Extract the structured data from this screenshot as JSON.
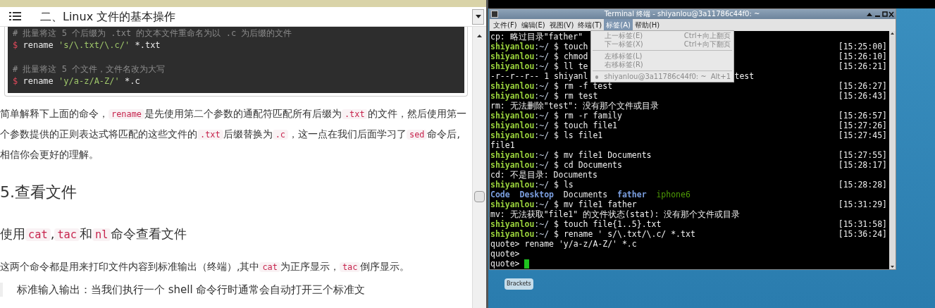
{
  "doc": {
    "title": "二、Linux 文件的基本操作",
    "code_lines": [
      {
        "kind": "comment",
        "text": "# 批量将这 5 个后缀为 .txt 的文本文件重命名为以 .c 为后缀的文件"
      },
      {
        "kind": "command",
        "prompt": "$",
        "cmd": "rename",
        "arg": "'s/\\.txt/\\.c/'",
        "rest": "*.txt"
      },
      {
        "kind": "blank"
      },
      {
        "kind": "comment",
        "text": "# 批量将这 5 个文件，文件名改为大写"
      },
      {
        "kind": "command",
        "prompt": "$",
        "cmd": "rename",
        "arg": "'y/a-z/A-Z/'",
        "rest": "*.c"
      }
    ],
    "blocks": [
      {
        "kind": "paragraph",
        "segments": [
          {
            "kind": "text",
            "text": "简单解释下上面的命令，"
          },
          {
            "kind": "code",
            "text": "rename"
          },
          {
            "kind": "text",
            "text": "是先使用第二个参数的通配符匹配所有后缀为"
          },
          {
            "kind": "code",
            "text": ".txt"
          },
          {
            "kind": "text",
            "text": "的文件，然后使用第一个参数提供的正则表达式将匹配的这些文件的"
          },
          {
            "kind": "code",
            "text": ".txt"
          },
          {
            "kind": "text",
            "text": "后缀替换为"
          },
          {
            "kind": "code",
            "text": ".c"
          },
          {
            "kind": "text",
            "text": "，这一点在我们后面学习了"
          },
          {
            "kind": "code",
            "text": "sed"
          },
          {
            "kind": "text",
            "text": "命令后,相信你会更好的理解。"
          }
        ]
      },
      {
        "kind": "h2",
        "segments": [
          {
            "kind": "text",
            "text": "5.查看文件"
          }
        ]
      },
      {
        "kind": "h3",
        "segments": [
          {
            "kind": "text",
            "text": "使用"
          },
          {
            "kind": "code",
            "text": "cat"
          },
          {
            "kind": "text",
            "text": ","
          },
          {
            "kind": "code",
            "text": "tac"
          },
          {
            "kind": "text",
            "text": "和"
          },
          {
            "kind": "code",
            "text": "nl"
          },
          {
            "kind": "text",
            "text": "命令查看文件"
          }
        ]
      },
      {
        "kind": "paragraph",
        "segments": [
          {
            "kind": "text",
            "text": "这两个命令都是用来打印文件内容到标准输出（终端）,其中"
          },
          {
            "kind": "code",
            "text": "cat"
          },
          {
            "kind": "text",
            "text": "为正序显示，"
          },
          {
            "kind": "code",
            "text": "tac"
          },
          {
            "kind": "text",
            "text": "倒序显示。"
          }
        ]
      },
      {
        "kind": "quote",
        "segments": [
          {
            "kind": "text",
            "text": "标准输入输出：当我们执行一个 shell 命令行时通常会自动打开三个标准文"
          }
        ]
      }
    ]
  },
  "terminal": {
    "title": "Terminal 终端 - shiyanlou@3a11786c44f0: ~",
    "menus": [
      {
        "label": "文件(F)",
        "selected": false
      },
      {
        "label": "编辑(E)",
        "selected": false
      },
      {
        "label": "视图(V)",
        "selected": false
      },
      {
        "label": "终端(T)",
        "selected": false
      },
      {
        "label": "标签(A)",
        "selected": true
      },
      {
        "label": "帮助(H)",
        "selected": false
      }
    ],
    "open_menu": [
      {
        "kind": "item",
        "label": "上一标签(E)",
        "shortcut": "Ctrl+向上翻页",
        "disabled": true
      },
      {
        "kind": "item",
        "label": "下一标签(X)",
        "shortcut": "Ctrl+向下翻页",
        "disabled": true
      },
      {
        "kind": "separator"
      },
      {
        "kind": "item",
        "label": "左移标签(L)",
        "disabled": true
      },
      {
        "kind": "item",
        "label": "右移标签(R)",
        "disabled": true
      },
      {
        "kind": "separator"
      },
      {
        "kind": "radio",
        "label": "shiyanlou@3a11786c44f0: ~",
        "shortcut": "Alt+1",
        "disabled": true
      }
    ],
    "lines": [
      {
        "kind": "output",
        "text": "cp: 略过目录\"father\""
      },
      {
        "kind": "prompt",
        "user": "shiyanlou",
        "path": ":~/",
        "command": "$ touch",
        "time": "[15:25:00]"
      },
      {
        "kind": "prompt",
        "user": "shiyanlou",
        "path": ":~/",
        "command": "$ chmod",
        "time": "[15:26:10]"
      },
      {
        "kind": "prompt",
        "user": "shiyanlou",
        "path": ":~/",
        "command": "$ ll te",
        "time": "[15:26:21]"
      },
      {
        "kind": "output",
        "text": "-r--r--r-- 1 shiyanl",
        "tail": "test"
      },
      {
        "kind": "prompt",
        "user": "shiyanlou",
        "path": ":~/",
        "command": "$ rm -f test",
        "time": "[15:26:27]"
      },
      {
        "kind": "prompt",
        "user": "shiyanlou",
        "path": ":~/",
        "command": "$ rm test",
        "time": "[15:26:43]"
      },
      {
        "kind": "output",
        "text": "rm: 无法删除\"test\": 没有那个文件或目录"
      },
      {
        "kind": "prompt",
        "user": "shiyanlou",
        "path": ":~/",
        "command": "$ rm -r family",
        "time": "[15:26:57]"
      },
      {
        "kind": "prompt",
        "user": "shiyanlou",
        "path": ":~/",
        "command": "$ touch file1",
        "time": "[15:27:26]"
      },
      {
        "kind": "prompt",
        "user": "shiyanlou",
        "path": ":~/",
        "command": "$ ls file1",
        "time": "[15:27:45]"
      },
      {
        "kind": "output",
        "text": "file1"
      },
      {
        "kind": "prompt",
        "user": "shiyanlou",
        "path": ":~/",
        "command": "$ mv file1 Documents",
        "time": "[15:27:55]"
      },
      {
        "kind": "prompt",
        "user": "shiyanlou",
        "path": ":~/",
        "command": "$ cd Documents",
        "time": "[15:28:17]"
      },
      {
        "kind": "output",
        "text": "cd: 不是目录: Documents"
      },
      {
        "kind": "prompt",
        "user": "shiyanlou",
        "path": ":~/",
        "command": "$ ls",
        "time": "[15:28:28]"
      },
      {
        "kind": "listing",
        "entries": [
          {
            "name": "Code",
            "color": "#7b9fe0",
            "bold": true
          },
          {
            "name": "Desktop",
            "color": "#7b9fe0",
            "bold": true
          },
          {
            "name": "Documents",
            "color": "#e8e8e8",
            "bold": false
          },
          {
            "name": "father",
            "color": "#7b9fe0",
            "bold": true
          },
          {
            "name": "iphone6",
            "color": "#4e9a06",
            "bold": false
          }
        ]
      },
      {
        "kind": "prompt",
        "user": "shiyanlou",
        "path": ":~/",
        "command": "$ mv file1 father",
        "time": "[15:31:29]"
      },
      {
        "kind": "output",
        "text": "mv: 无法获取\"file1\" 的文件状态(stat): 没有那个文件或目录"
      },
      {
        "kind": "prompt",
        "user": "shiyanlou",
        "path": ":~/",
        "command": "$ touch file{1..5}.txt",
        "time": "[15:31:58]"
      },
      {
        "kind": "prompt",
        "user": "shiyanlou",
        "path": ":~/",
        "command": "$ rename ' s/\\.txt/\\.c/ *.txt",
        "time": "[15:36:24]"
      },
      {
        "kind": "output",
        "text": "quote> rename 'y/a-z/A-Z/' *.c"
      },
      {
        "kind": "output",
        "text": "quote>"
      },
      {
        "kind": "cursor",
        "text": "quote>"
      }
    ]
  },
  "desktop": {
    "label": "Brackets"
  }
}
